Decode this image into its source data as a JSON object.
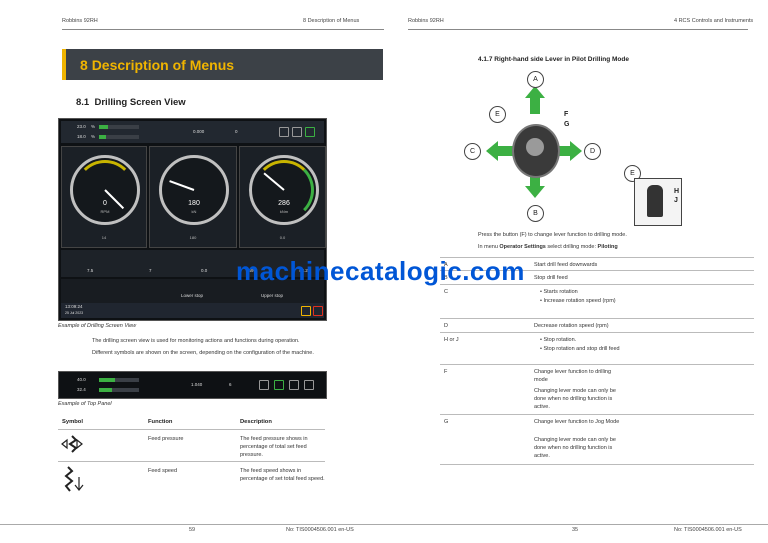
{
  "left_page": {
    "header_left": "Robbins 92RH",
    "header_right": "8 Description of Menus",
    "chapter_number": "8",
    "chapter_title": "Description of Menus",
    "section_number": "8.1",
    "section_title": "Drilling Screen View",
    "screen": {
      "feed_pressure": "23.0",
      "feed_speed": "18.0",
      "percent_unit": "%",
      "top_value_1": "0.000",
      "top_value_2": "0",
      "gauge_left_value": "0",
      "gauge_left_unit": "RPM",
      "gauge_left_sub": "14",
      "gauge_mid_value": "180",
      "gauge_mid_unit": "kN",
      "gauge_mid_sub": "180",
      "gauge_right_value": "286",
      "gauge_right_unit": "kNm",
      "gauge_right_sub": "0.0",
      "stat_1": "7.5",
      "stat_2": "7",
      "stat_3": "0.0",
      "stat_4": "-49.8",
      "stat_5": "43.2",
      "mid_label_1": "Lower stop",
      "mid_label_2": "Upper stop",
      "clock_time": "13:09:24",
      "clock_date": "25 Jul 2023"
    },
    "screen_caption": "Example of Drilling Screen View",
    "para_1": "The drilling screen view is used for monitoring actions and functions during operation.",
    "para_2": "Different symbols are shown on the screen, depending on the configuration of the machine.",
    "top_panel": {
      "feed_pressure": "40.0",
      "feed_speed": "32.4",
      "value_1": "1.040",
      "value_2": "6"
    },
    "top_panel_caption": "Example of Top Panel",
    "table": {
      "headers": [
        "Symbol",
        "Function",
        "Description"
      ],
      "rows": [
        {
          "function": "Feed pressure",
          "description": "The feed pressure shows in percentage of total set feed pressure."
        },
        {
          "function": "Feed speed",
          "description": "The feed speed shows in percentage of set total feed speed."
        }
      ]
    },
    "footer_page": "59",
    "footer_doc": "No: TIS0004506.001 en-US"
  },
  "right_page": {
    "header_left": "Robbins 92RH",
    "header_right": "4 RCS Controls and Instruments",
    "section_title": "4.1.7 Right-hand side Lever in Pilot Drilling Mode",
    "diagram_labels": [
      "A",
      "B",
      "C",
      "D",
      "E",
      "F",
      "G",
      "E",
      "H",
      "J"
    ],
    "para_1": "Press the button (F) to change lever function to drilling mode.",
    "para_2_prefix": "In menu",
    "para_2_bold": "Operator Settings",
    "para_2_mid": "select drilling mode:",
    "para_2_bold2": "Piloting",
    "table_rows": [
      {
        "key": "A",
        "lines": [
          "Start drill feed downwards"
        ]
      },
      {
        "key": "B",
        "lines": [
          "Stop drill feed"
        ]
      },
      {
        "key": "C",
        "bullets": [
          "Starts rotation",
          "Increase rotation speed (rpm)"
        ]
      },
      {
        "key": "D",
        "lines": [
          "Decrease rotation speed (rpm)"
        ]
      },
      {
        "key": "H or J",
        "bullets": [
          "Stop rotation.",
          "Stop rotation and stop drill feed"
        ]
      },
      {
        "key": "F",
        "lines": [
          "Change lever function to drilling mode",
          "Changing lever mode can only be done when no drilling function is active."
        ]
      },
      {
        "key": "G",
        "lines": [
          "Change lever function to Jog Mode",
          "Changing lever mode can only be done when no drilling function is active."
        ]
      }
    ],
    "footer_page": "35",
    "footer_doc": "No: TIS0004506.001 en-US"
  },
  "watermark": "machinecatalogic.com",
  "colors": {
    "accent": "#f0b400",
    "banner": "#3c4147",
    "green": "#3cb043",
    "watermark": "#0056d6"
  }
}
